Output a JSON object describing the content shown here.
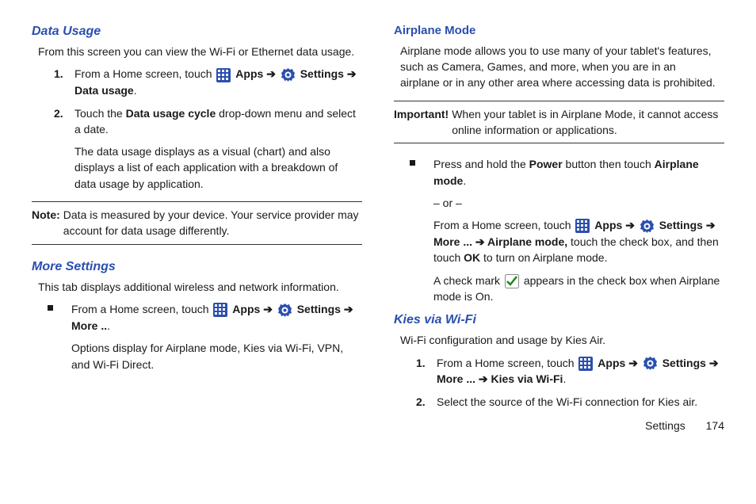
{
  "left": {
    "dataUsage": {
      "heading": "Data Usage",
      "intro": "From this screen you can view the Wi-Fi or Ethernet data usage.",
      "step1a": "From a Home screen, touch ",
      "step1b_apps": "Apps",
      "step1c_arrow": " ➔ ",
      "step1d_settings": "Settings",
      "step1e_arrow": " ➔ ",
      "step1f_du": "Data usage",
      "step1g": ".",
      "step2a": "Touch the ",
      "step2b": "Data usage cycle",
      "step2c": " drop-down menu and select a date.",
      "step2para": "The data usage displays as a visual (chart) and also displays a list of each application with a breakdown of data usage by application.",
      "noteLabel": "Note:",
      "noteBody": "Data is measured by your device. Your service provider may account for data usage differently."
    },
    "moreSettings": {
      "heading": "More Settings",
      "intro": "This tab displays additional wireless and network information.",
      "b1a": "From a Home screen, touch ",
      "b1b_apps": "Apps",
      "b1c_arrow": " ➔ ",
      "b1d_settings": "Settings",
      "b1e_arrow": " ➔ ",
      "b1f_more": "More ..",
      "b1g": ".",
      "b1para": "Options display for Airplane mode, Kies via Wi-Fi, VPN, and Wi-Fi Direct."
    }
  },
  "right": {
    "airplane": {
      "heading": "Airplane Mode",
      "intro": "Airplane mode allows you to use many of your tablet's features, such as Camera, Games, and more, when you are in an airplane or in any other area where accessing data is prohibited.",
      "impLabel": "Important!",
      "impBody": "When your tablet is in Airplane Mode, it cannot access online information or applications.",
      "b1a": "Press and hold the ",
      "b1b": "Power",
      "b1c": " button then touch ",
      "b1d": "Airplane mode",
      "b1e": ".",
      "or": "– or –",
      "b2a": "From a Home screen, touch ",
      "b2b_apps": "Apps",
      "b2c_arrow": " ➔ ",
      "b2d_settings": "Settings",
      "b2e_arrow": " ➔ ",
      "b2f_more": "More ...",
      "b2g_arrow": " ➔ ",
      "b2h_am": "Airplane mode,",
      "b2i": " touch the check box, and then touch ",
      "b2j_ok": "OK",
      "b2k": " to turn on Airplane mode.",
      "b3a": "A check mark ",
      "b3b": " appears in the check box when Airplane mode is On."
    },
    "kies": {
      "heading": "Kies via Wi-Fi",
      "intro": "Wi-Fi configuration and usage by Kies Air.",
      "step1a": "From a Home screen, touch ",
      "step1b_apps": "Apps",
      "step1c_arrow": " ➔ ",
      "step1d_settings": "Settings",
      "step1e_arrow": " ➔ ",
      "step1f_more": "More ...",
      "step1g_arrow": " ➔ ",
      "step1h_kies": "Kies via Wi-Fi",
      "step1i": ".",
      "step2": "Select the source of the Wi-Fi connection for Kies air."
    }
  },
  "footer": {
    "section": "Settings",
    "page": "174"
  },
  "labels": {
    "one": "1.",
    "two": "2."
  }
}
